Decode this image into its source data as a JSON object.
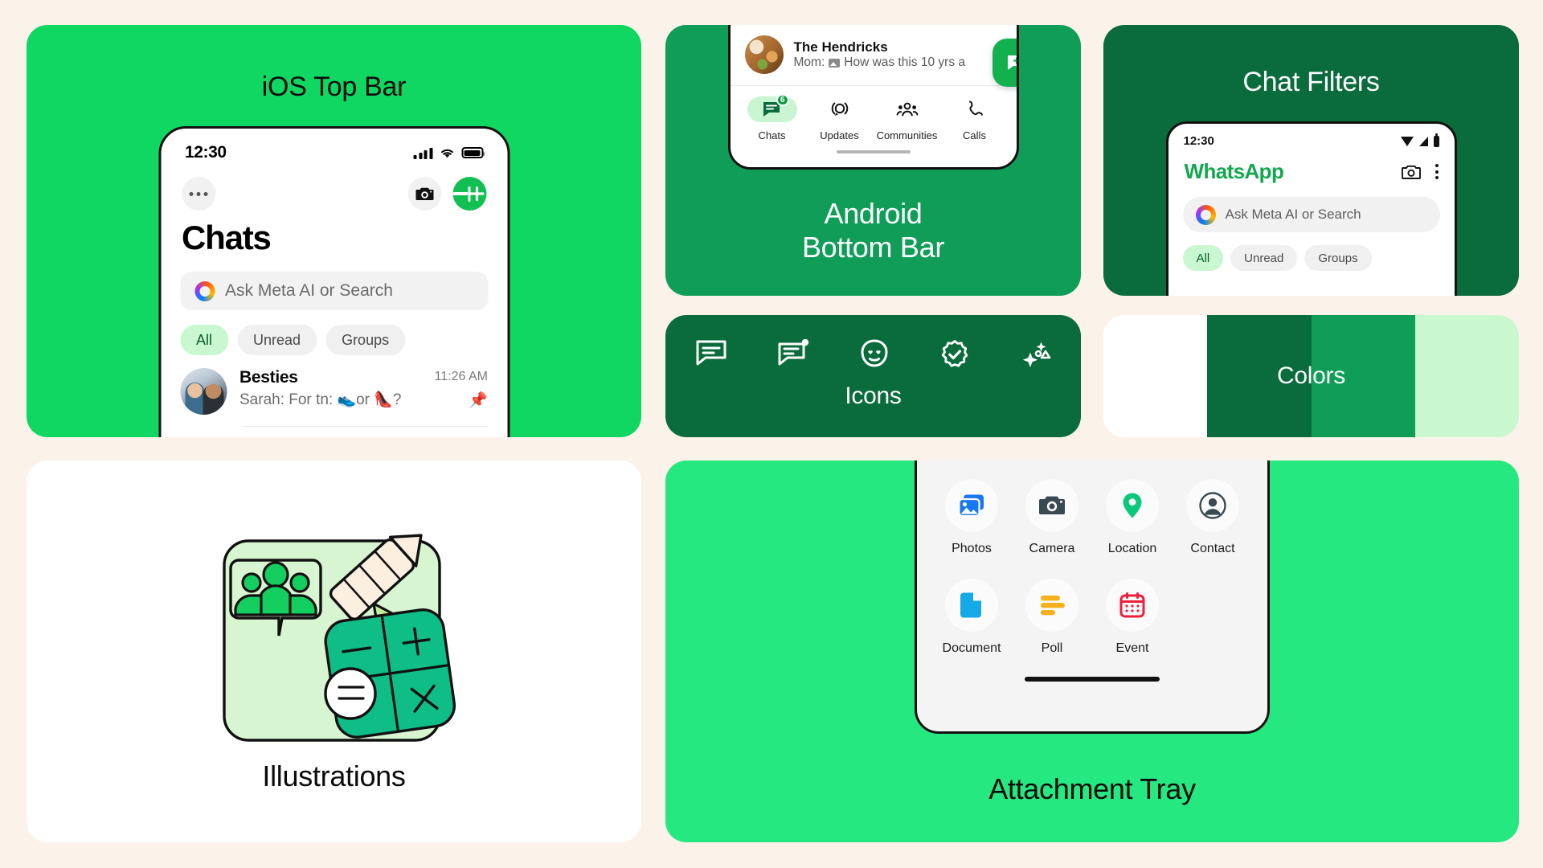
{
  "theme": {
    "page_background": "#fbf3e9",
    "brand_green": "#10d762",
    "dark_green": "#0a6b3c",
    "mid_green": "#0f9d58",
    "light_green": "#c9f7cf",
    "attachment_card_green": "#26e880"
  },
  "cards": {
    "ios_top_bar": {
      "title": "iOS Top Bar",
      "status": {
        "time": "12:30",
        "signal_icon": "cellular-signal-icon",
        "wifi_icon": "wifi-icon",
        "battery_icon": "battery-icon"
      },
      "toolbar": {
        "more_label": "•••",
        "camera_icon": "camera-icon",
        "new_chat_icon": "plus-icon"
      },
      "heading": "Chats",
      "search": {
        "placeholder": "Ask Meta AI or Search",
        "icon": "meta-ai-ring-icon"
      },
      "filters": [
        {
          "label": "All",
          "active": true
        },
        {
          "label": "Unread",
          "active": false
        },
        {
          "label": "Groups",
          "active": false
        }
      ],
      "chat": {
        "name": "Besties",
        "snippet": "Sarah: For tn: 👟or 👠?",
        "time": "11:26 AM",
        "pin_icon": "📌"
      }
    },
    "android_bottom_bar": {
      "title_line1": "Android",
      "title_line2": "Bottom Bar",
      "chat_preview": {
        "name": "The Hendricks",
        "snippet_prefix": "Mom:",
        "snippet": "How was this 10 yrs a",
        "image_icon": "image-attachment-icon"
      },
      "fab": {
        "icon": "new-chat-icon"
      },
      "tabs": [
        {
          "label": "Chats",
          "icon": "chats-icon",
          "badge": "6",
          "active": true
        },
        {
          "label": "Updates",
          "icon": "updates-status-icon",
          "badge": "",
          "active": false
        },
        {
          "label": "Communities",
          "icon": "communities-icon",
          "badge": "",
          "active": false
        },
        {
          "label": "Calls",
          "icon": "phone-call-icon",
          "badge": "",
          "active": false
        }
      ]
    },
    "chat_filters": {
      "title": "Chat Filters",
      "status": {
        "time": "12:30",
        "wifi_icon": "wifi-icon",
        "signal_icon": "cellular-signal-icon",
        "battery_icon": "battery-icon"
      },
      "header": {
        "brand": "WhatsApp",
        "camera_icon": "camera-icon",
        "overflow_icon": "kebab-menu-icon"
      },
      "search": {
        "placeholder": "Ask Meta AI or Search",
        "icon": "meta-ai-ring-icon"
      },
      "filters": [
        {
          "label": "All",
          "active": true
        },
        {
          "label": "Unread",
          "active": false
        },
        {
          "label": "Groups",
          "active": false
        }
      ]
    },
    "icons": {
      "title": "Icons",
      "items": [
        {
          "name": "chat-bubble-icon"
        },
        {
          "name": "chat-bubble-unread-dot-icon"
        },
        {
          "name": "smiley-heart-eyes-icon"
        },
        {
          "name": "verified-badge-icon"
        },
        {
          "name": "ai-sparkles-icon"
        }
      ]
    },
    "colors": {
      "title": "Colors",
      "swatches": [
        "#ffffff",
        "#0a6b3c",
        "#0f9d58",
        "#c9f7cf"
      ]
    },
    "illustrations": {
      "title": "Illustrations",
      "artwork_name": "education-group-apple-pencil-calculator-illustration"
    },
    "attachment_tray": {
      "title": "Attachment Tray",
      "items": [
        {
          "label": "Photos",
          "icon": "photos-icon",
          "color": "#1877f2"
        },
        {
          "label": "Camera",
          "icon": "camera-icon",
          "color": "#3a4a52"
        },
        {
          "label": "Location",
          "icon": "location-pin-icon",
          "color": "#0ac97a"
        },
        {
          "label": "Contact",
          "icon": "contact-person-icon",
          "color": "#3a4a52"
        },
        {
          "label": "Document",
          "icon": "document-icon",
          "color": "#16a9e8"
        },
        {
          "label": "Poll",
          "icon": "poll-icon",
          "color": "#f5b01d"
        },
        {
          "label": "Event",
          "icon": "event-calendar-icon",
          "color": "#ee1f3c"
        }
      ]
    }
  }
}
